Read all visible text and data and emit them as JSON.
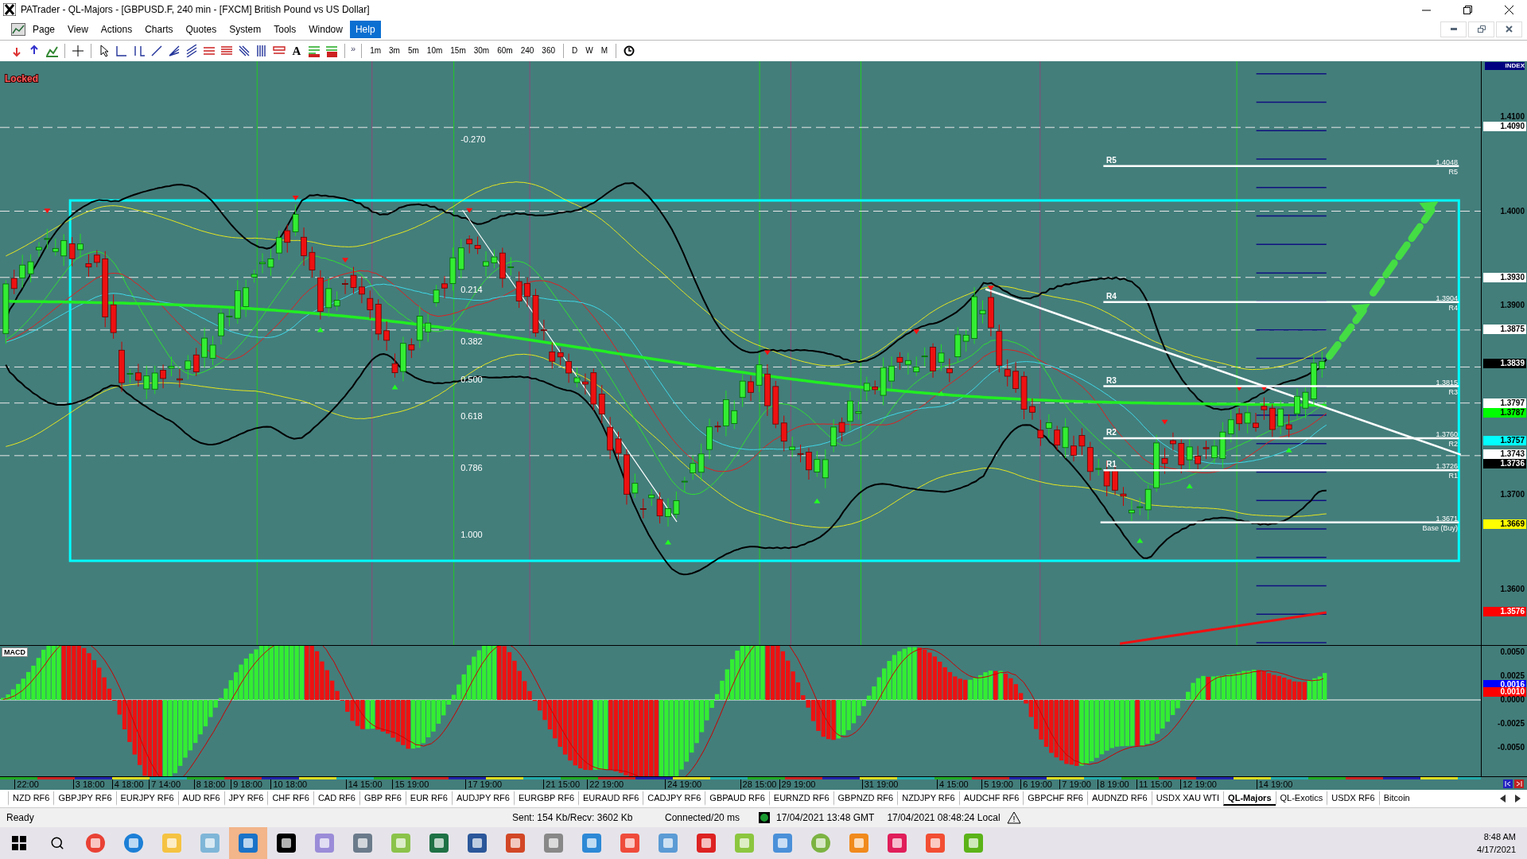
{
  "window": {
    "title": "PATrader - QL-Majors - [GBPUSD.F, 240 min - [FXCM] British Pound vs US Dollar]"
  },
  "menu": [
    {
      "label": "Page",
      "selected": false
    },
    {
      "label": "View",
      "selected": false
    },
    {
      "label": "Actions",
      "selected": false
    },
    {
      "label": "Charts",
      "selected": false
    },
    {
      "label": "Quotes",
      "selected": false
    },
    {
      "label": "System",
      "selected": false
    },
    {
      "label": "Tools",
      "selected": false
    },
    {
      "label": "Window",
      "selected": false
    },
    {
      "label": "Help",
      "selected": true
    }
  ],
  "toolbar": {
    "text_tool": "A",
    "overflow": "»",
    "timeframes": [
      "1m",
      "3m",
      "5m",
      "10m",
      "15m",
      "30m",
      "60m",
      "240",
      "360"
    ],
    "periods": [
      "D",
      "W",
      "M"
    ]
  },
  "chart": {
    "lock_label": "Locked",
    "index_label": "INDEX",
    "fib_levels": [
      "-0.270",
      "0.214",
      "0.382",
      "0.500",
      "0.618",
      "0.786",
      "1.000"
    ],
    "pivots": [
      {
        "left": "R5",
        "value": "1.4048",
        "right": "R5"
      },
      {
        "left": "R4",
        "value": "1.3904",
        "right": "R4"
      },
      {
        "left": "R3",
        "value": "1.3815",
        "right": "R3"
      },
      {
        "left": "R2",
        "value": "1.3760",
        "right": "R2"
      },
      {
        "left": "R1",
        "value": "1.3726",
        "right": "R1"
      },
      {
        "value": "1.3671",
        "right": "Base (Buy)"
      }
    ],
    "price_axis": [
      {
        "label": "1.4100",
        "kind": "tick"
      },
      {
        "label": "1.4090",
        "kind": "marker",
        "color": "#ffffff"
      },
      {
        "label": "1.4000",
        "kind": "tick"
      },
      {
        "label": "1.3930",
        "kind": "marker",
        "color": "#ffffff"
      },
      {
        "label": "1.3900",
        "kind": "tick"
      },
      {
        "label": "1.3875",
        "kind": "marker",
        "color": "#ffffff"
      },
      {
        "label": "1.3839",
        "kind": "marker",
        "color": "#000000"
      },
      {
        "label": "1.3797",
        "kind": "marker",
        "color": "#ffffff"
      },
      {
        "label": "1.3787",
        "kind": "marker",
        "color": "#00ff00"
      },
      {
        "label": "1.3757",
        "kind": "marker",
        "color": "#00ffff"
      },
      {
        "label": "1.3743",
        "kind": "marker",
        "color": "#ffffff"
      },
      {
        "label": "1.3736",
        "kind": "marker",
        "color": "#000000"
      },
      {
        "label": "1.3700",
        "kind": "tick"
      },
      {
        "label": "1.3669",
        "kind": "marker",
        "color": "#ffff00"
      },
      {
        "label": "1.3600",
        "kind": "tick"
      },
      {
        "label": "1.3576",
        "kind": "marker",
        "color": "#ff0000"
      }
    ]
  },
  "macd": {
    "label": "MACD",
    "axis": [
      {
        "label": "0.0050",
        "kind": "tick"
      },
      {
        "label": "0.0025",
        "kind": "tick"
      },
      {
        "label": "0.0016",
        "kind": "marker",
        "color": "#0000ff"
      },
      {
        "label": "0.0010",
        "kind": "marker",
        "color": "#ff0000"
      },
      {
        "label": "0.0000",
        "kind": "tick"
      },
      {
        "label": "-0.0025",
        "kind": "tick"
      },
      {
        "label": "-0.0050",
        "kind": "tick"
      }
    ]
  },
  "time_axis": [
    "22:00",
    "3 18:00",
    "4 18:00",
    "7 14:00",
    "8 18:00",
    "9 18:00",
    "10 18:00",
    "14 15:00",
    "15 19:00",
    "17 19:00",
    "21 15:00",
    "22 19:00",
    "24 19:00",
    "28 15:00",
    "29 19:00",
    "31 19:00",
    "4 15:00",
    "5 19:00",
    "6 19:00",
    "7 19:00",
    "8 19:00",
    "11 15:00",
    "12 19:00",
    "14 19:00"
  ],
  "sheet_tabs": [
    {
      "label": "NZD RF6",
      "selected": false
    },
    {
      "label": "GBPJPY RF6",
      "selected": false
    },
    {
      "label": "EURJPY RF6",
      "selected": false
    },
    {
      "label": "AUD RF6",
      "selected": false
    },
    {
      "label": "JPY RF6",
      "selected": false
    },
    {
      "label": "CHF RF6",
      "selected": false
    },
    {
      "label": "CAD RF6",
      "selected": false
    },
    {
      "label": "GBP RF6",
      "selected": false
    },
    {
      "label": "EUR RF6",
      "selected": false
    },
    {
      "label": "AUDJPY RF6",
      "selected": false
    },
    {
      "label": "EURGBP RF6",
      "selected": false
    },
    {
      "label": "EURAUD RF6",
      "selected": false
    },
    {
      "label": "CADJPY RF6",
      "selected": false
    },
    {
      "label": "GBPAUD RF6",
      "selected": false
    },
    {
      "label": "EURNZD RF6",
      "selected": false
    },
    {
      "label": "GBPNZD RF6",
      "selected": false
    },
    {
      "label": "NZDJPY RF6",
      "selected": false
    },
    {
      "label": "AUDCHF RF6",
      "selected": false
    },
    {
      "label": "GBPCHF RF6",
      "selected": false
    },
    {
      "label": "AUDNZD RF6",
      "selected": false
    },
    {
      "label": "USDX XAU WTI",
      "selected": false
    },
    {
      "label": "QL-Majors",
      "selected": true
    },
    {
      "label": "QL-Exotics",
      "selected": false
    },
    {
      "label": "USDX RF6",
      "selected": false
    },
    {
      "label": "Bitcoin",
      "selected": false
    }
  ],
  "status_bar": {
    "state": "Ready",
    "traffic": "Sent: 154 Kb/Recv: 3602 Kb",
    "connection": "Connected/20 ms",
    "gmt_time": "17/04/2021 13:48 GMT",
    "local_time": "17/04/2021 08:48:24 Local"
  },
  "taskbar": {
    "time": "8:48 AM",
    "date": "4/17/2021"
  }
}
